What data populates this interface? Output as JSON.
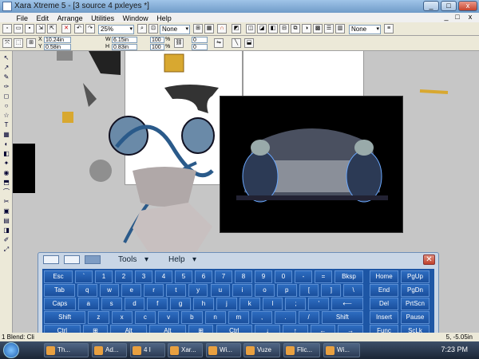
{
  "window": {
    "title": "Xara Xtreme 5 - [3 source 4 pxleyes *]",
    "controls": [
      "_",
      "□",
      "x"
    ],
    "mdi_controls": [
      "_",
      "□",
      "x"
    ]
  },
  "menu": [
    "File",
    "Edit",
    "Arrange",
    "Utilities",
    "Window",
    "Help"
  ],
  "toolbar": {
    "zoom": "25%",
    "fill_none": "None",
    "line_none": "None",
    "x": "10.24in",
    "y": "0.58in",
    "w": "6.15in",
    "h": "0.83in",
    "scale_w": "100",
    "scale_h": "100",
    "angle": "0",
    "skew": "0"
  },
  "left_tools": [
    "↖",
    "↗",
    "✎",
    "✑",
    "◻",
    "○",
    "☆",
    "T",
    "▦",
    "◐",
    "◧",
    "✦",
    "◉",
    "⬒",
    "⌒",
    "✂",
    "▣",
    "▤",
    "◨",
    "✐",
    "⤢"
  ],
  "keyboard": {
    "menu_tools": "Tools",
    "menu_help": "Help",
    "rows": [
      [
        "Esc",
        "`",
        "1",
        "2",
        "3",
        "4",
        "5",
        "6",
        "7",
        "8",
        "9",
        "0",
        "-",
        "=",
        "Bksp"
      ],
      [
        "Tab",
        "q",
        "w",
        "e",
        "r",
        "t",
        "y",
        "u",
        "i",
        "o",
        "p",
        "[",
        "]",
        "\\"
      ],
      [
        "Caps",
        "a",
        "s",
        "d",
        "f",
        "g",
        "h",
        "j",
        "k",
        "l",
        ";",
        "'",
        "⟵"
      ],
      [
        "Shift",
        "z",
        "x",
        "c",
        "v",
        "b",
        "n",
        "m",
        ",",
        ".",
        "/",
        "Shift"
      ],
      [
        "Ctrl",
        "⊞",
        "Alt",
        "Alt",
        "⊞",
        "Ctrl",
        "↓",
        "↑",
        "←",
        "→"
      ]
    ],
    "side_keys": [
      [
        "Home",
        "PgUp"
      ],
      [
        "End",
        "PgDn"
      ],
      [
        "Del",
        "PrtScn"
      ],
      [
        "Insert",
        "Pause"
      ],
      [
        "Func",
        "ScLk"
      ]
    ]
  },
  "status": {
    "left": "1 Blend: Cli",
    "coords": "5, -5.05in"
  },
  "taskbar": {
    "items": [
      "Th...",
      "Ad...",
      "4 I",
      "Xar...",
      "Wi...",
      "Vuze",
      "Flic...",
      "Wi..."
    ],
    "clock": "7:23 PM"
  }
}
